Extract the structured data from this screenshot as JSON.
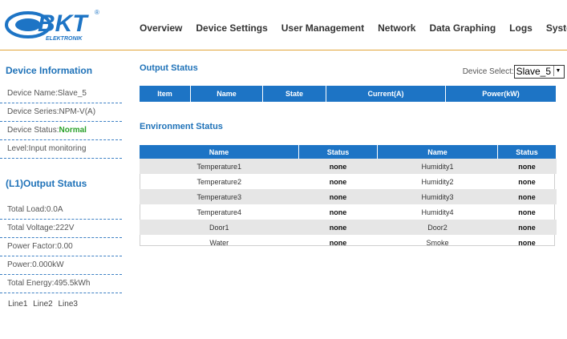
{
  "logo": {
    "text": "BKT",
    "subtext": "ELEKTRONIK",
    "mark": "®"
  },
  "nav": [
    "Overview",
    "Device Settings",
    "User Management",
    "Network",
    "Data Graphing",
    "Logs",
    "System"
  ],
  "sidebar": {
    "device_info_title": "Device Information",
    "device_name": "Device Name:Slave_5",
    "device_series": "Device Series:NPM-V(A)",
    "device_status_label": "Device Status:",
    "device_status_value": "Normal",
    "level": "Level:Input monitoring",
    "output_title": "(L1)Output Status",
    "total_load": "Total Load:0.0A",
    "total_voltage": "Total Voltage:222V",
    "power_factor": "Power Factor:0.00",
    "power": "Power:0.000kW",
    "total_energy": "Total Energy:495.5kWh",
    "lines": "Line1 Line2 Line3"
  },
  "main": {
    "output_title": "Output Status",
    "device_select_label": "Device Select:",
    "device_select_value": "Slave_5",
    "output_headers": [
      "Item",
      "Name",
      "State",
      "Current(A)",
      "Power(kW)"
    ],
    "env_title": "Environment Status",
    "env_headers": [
      "Name",
      "Status",
      "Name",
      "Status"
    ],
    "env_rows": [
      [
        "Temperature1",
        "none",
        "Humidity1",
        "none"
      ],
      [
        "Temperature2",
        "none",
        "Humidity2",
        "none"
      ],
      [
        "Temperature3",
        "none",
        "Humidity3",
        "none"
      ],
      [
        "Temperature4",
        "none",
        "Humidity4",
        "none"
      ],
      [
        "Door1",
        "none",
        "Door2",
        "none"
      ],
      [
        "Water",
        "none",
        "Smoke",
        "none"
      ]
    ]
  },
  "colors": {
    "accent": "#1d74c5",
    "title": "#1f72b8",
    "status_ok": "#2aa12a",
    "header_line": "#e3a63a"
  }
}
